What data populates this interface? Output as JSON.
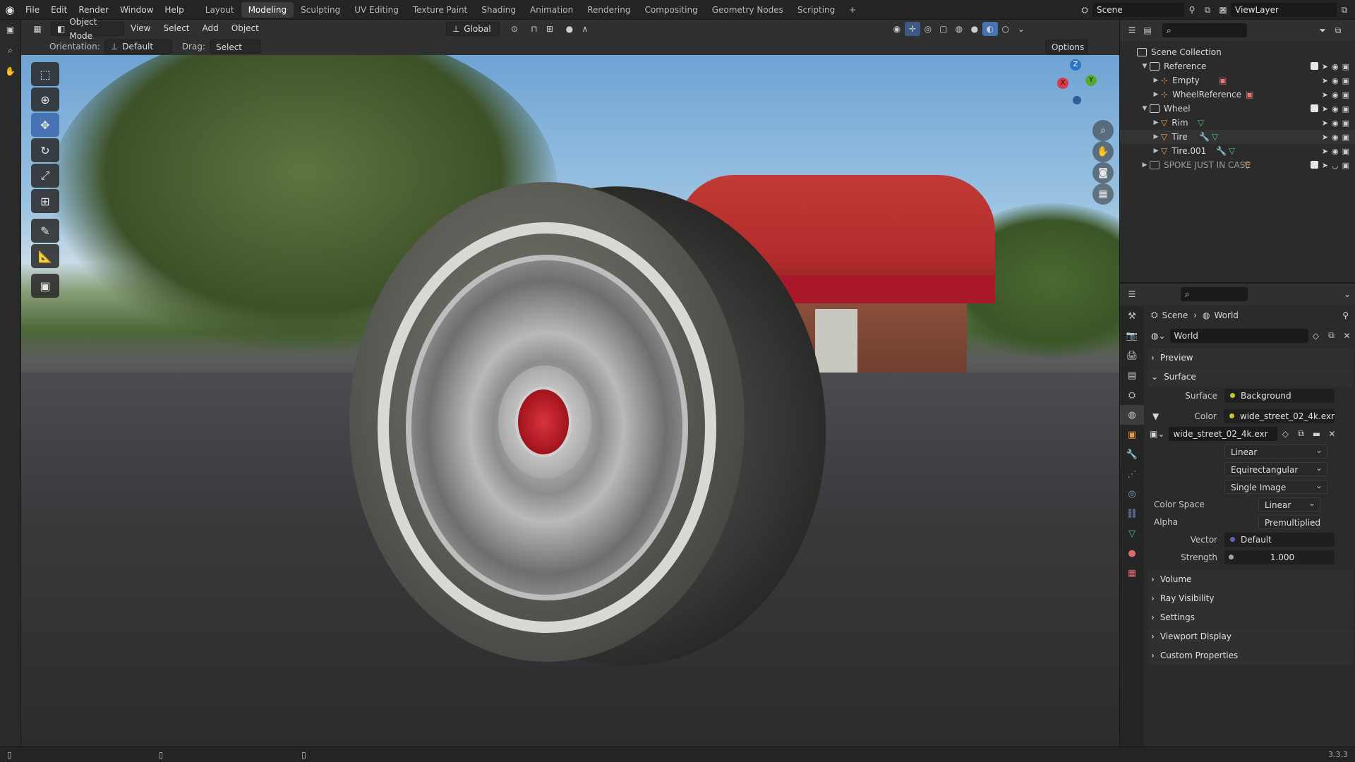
{
  "topbar": {
    "menus": [
      "File",
      "Edit",
      "Render",
      "Window",
      "Help"
    ],
    "workspaces": [
      "Layout",
      "Modeling",
      "Sculpting",
      "UV Editing",
      "Texture Paint",
      "Shading",
      "Animation",
      "Rendering",
      "Compositing",
      "Geometry Nodes",
      "Scripting"
    ],
    "active_workspace": "Modeling",
    "add_tab": "+",
    "scene": "Scene",
    "view_layer": "ViewLayer"
  },
  "viewport_header": {
    "mode": "Object Mode",
    "menus": [
      "View",
      "Select",
      "Add",
      "Object"
    ],
    "transform_orientation": "Global",
    "orientation_label": "Orientation:",
    "orientation_value": "Default",
    "drag_label": "Drag:",
    "drag_value": "Select Box",
    "options": "Options"
  },
  "gizmo": {
    "z": "Z",
    "y": "Y",
    "x": "X"
  },
  "tools": [
    "select-box",
    "cursor",
    "move",
    "rotate",
    "scale",
    "transform",
    "annotate",
    "measure",
    "add-cube"
  ],
  "outliner": {
    "root": "Scene Collection",
    "rows": [
      {
        "label": "Reference",
        "type": "collection",
        "level": 1
      },
      {
        "label": "Empty",
        "type": "object",
        "level": 2
      },
      {
        "label": "WheelReference",
        "type": "object",
        "level": 2
      },
      {
        "label": "Wheel",
        "type": "collection",
        "level": 1
      },
      {
        "label": "Rim",
        "type": "object",
        "level": 2
      },
      {
        "label": "Tire",
        "type": "object",
        "level": 2
      },
      {
        "label": "Tire.001",
        "type": "object",
        "level": 2
      },
      {
        "label": "SPOKE JUST IN CASE",
        "type": "collection",
        "level": 1
      }
    ]
  },
  "properties": {
    "breadcrumb_scene": "Scene",
    "breadcrumb_world": "World",
    "world_name": "World",
    "panels": {
      "preview": "Preview",
      "surface": "Surface",
      "volume": "Volume",
      "ray_visibility": "Ray Visibility",
      "settings": "Settings",
      "viewport_display": "Viewport Display",
      "custom_properties": "Custom Properties"
    },
    "surface_label": "Surface",
    "surface_value": "Background",
    "color_label": "Color",
    "color_value": "wide_street_02_4k.exr",
    "image_name": "wide_street_02_4k.exr",
    "interpolation": "Linear",
    "projection": "Equirectangular",
    "source": "Single Image",
    "color_space_label": "Color Space",
    "color_space_value": "Linear",
    "alpha_label": "Alpha",
    "alpha_value": "Premultiplied",
    "vector_label": "Vector",
    "vector_value": "Default",
    "strength_label": "Strength",
    "strength_value": "1.000"
  },
  "statusbar": {
    "version": "3.3.3"
  },
  "colors": {
    "accent": "#4772b3",
    "panel": "#2b2b2b",
    "header": "#303030"
  }
}
